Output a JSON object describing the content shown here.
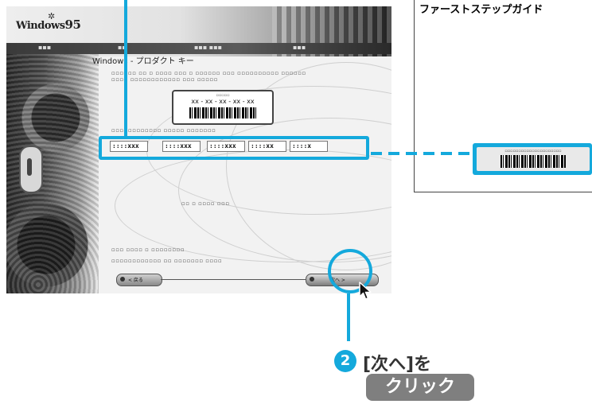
{
  "guide": {
    "title": "ファーストステップガイド"
  },
  "installer": {
    "logo_text": "Windows",
    "logo_version": "95",
    "page_heading": "Windows - プロダクト キー",
    "key_fields": [
      "::::xxx",
      "::::xxx",
      "::::xxx",
      "::::xx",
      "::::x"
    ],
    "sticker_code": "xx - xx - xx - xx - xx",
    "back_label": "< 戻る",
    "next_label": "次へ >"
  },
  "instruction": {
    "step_number": "2",
    "text": "[次へ]を",
    "action": "クリック"
  },
  "colors": {
    "accent": "#14a9dc",
    "action_badge": "#7f7f7f"
  },
  "icons": {
    "cursor": "mouse-pointer-icon",
    "logo": "windows-flag-icon"
  }
}
